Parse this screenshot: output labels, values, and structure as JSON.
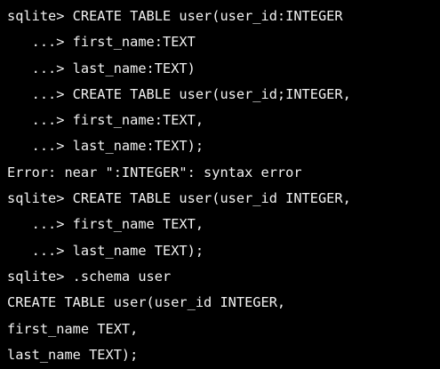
{
  "colors": {
    "background": "#000000",
    "text": "#f2f2f2"
  },
  "terminal": {
    "lines": [
      "sqlite> CREATE TABLE user(user_id:INTEGER",
      "   ...> first_name:TEXT",
      "   ...> last_name:TEXT)",
      "   ...> CREATE TABLE user(user_id;INTEGER,",
      "   ...> first_name:TEXT,",
      "   ...> last_name:TEXT);",
      "Error: near \":INTEGER\": syntax error",
      "sqlite> CREATE TABLE user(user_id INTEGER,",
      "   ...> first_name TEXT,",
      "   ...> last_name TEXT);",
      "sqlite> .schema user",
      "CREATE TABLE user(user_id INTEGER,",
      "first_name TEXT,",
      "last_name TEXT);"
    ]
  }
}
